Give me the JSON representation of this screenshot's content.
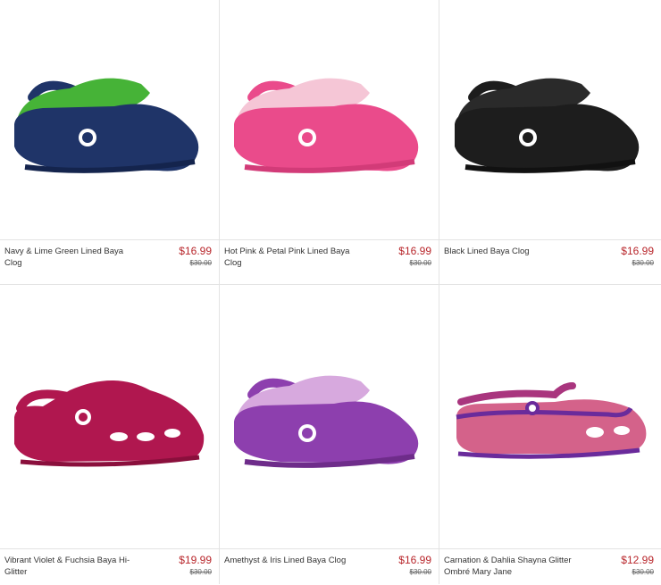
{
  "products": [
    {
      "name": "Navy & Lime Green Lined Baya Clog",
      "price": "$16.99",
      "was": "$30.00",
      "colors": {
        "body": "#1f3468",
        "lining": "#46b337",
        "strap": "#1f3468"
      }
    },
    {
      "name": "Hot Pink & Petal Pink Lined Baya Clog",
      "price": "$16.99",
      "was": "$30.00",
      "colors": {
        "body": "#ea4b8b",
        "lining": "#f5c6d6",
        "strap": "#ea4b8b"
      }
    },
    {
      "name": "Black Lined Baya Clog",
      "price": "$16.99",
      "was": "$30.00",
      "colors": {
        "body": "#1d1d1d",
        "lining": "#2a2a2a",
        "strap": "#1d1d1d"
      }
    },
    {
      "name": "Vibrant Violet & Fuchsia Baya Hi-Glitter",
      "price": "$19.99",
      "was": "$30.00",
      "colors": {
        "body": "#b0174f",
        "lining": "#b0174f",
        "strap": "#b0174f"
      }
    },
    {
      "name": "Amethyst & Iris Lined Baya Clog",
      "price": "$16.99",
      "was": "$30.00",
      "colors": {
        "body": "#8d3fae",
        "lining": "#d7a9de",
        "strap": "#8d3fae"
      }
    },
    {
      "name": "Carnation & Dahlia Shayna Glitter Ombré Mary Jane",
      "price": "$12.99",
      "was": "$30.00",
      "colors": {
        "body": "#d4628a",
        "lining": "#6a2b9b",
        "strap": "#a9357e"
      }
    }
  ]
}
